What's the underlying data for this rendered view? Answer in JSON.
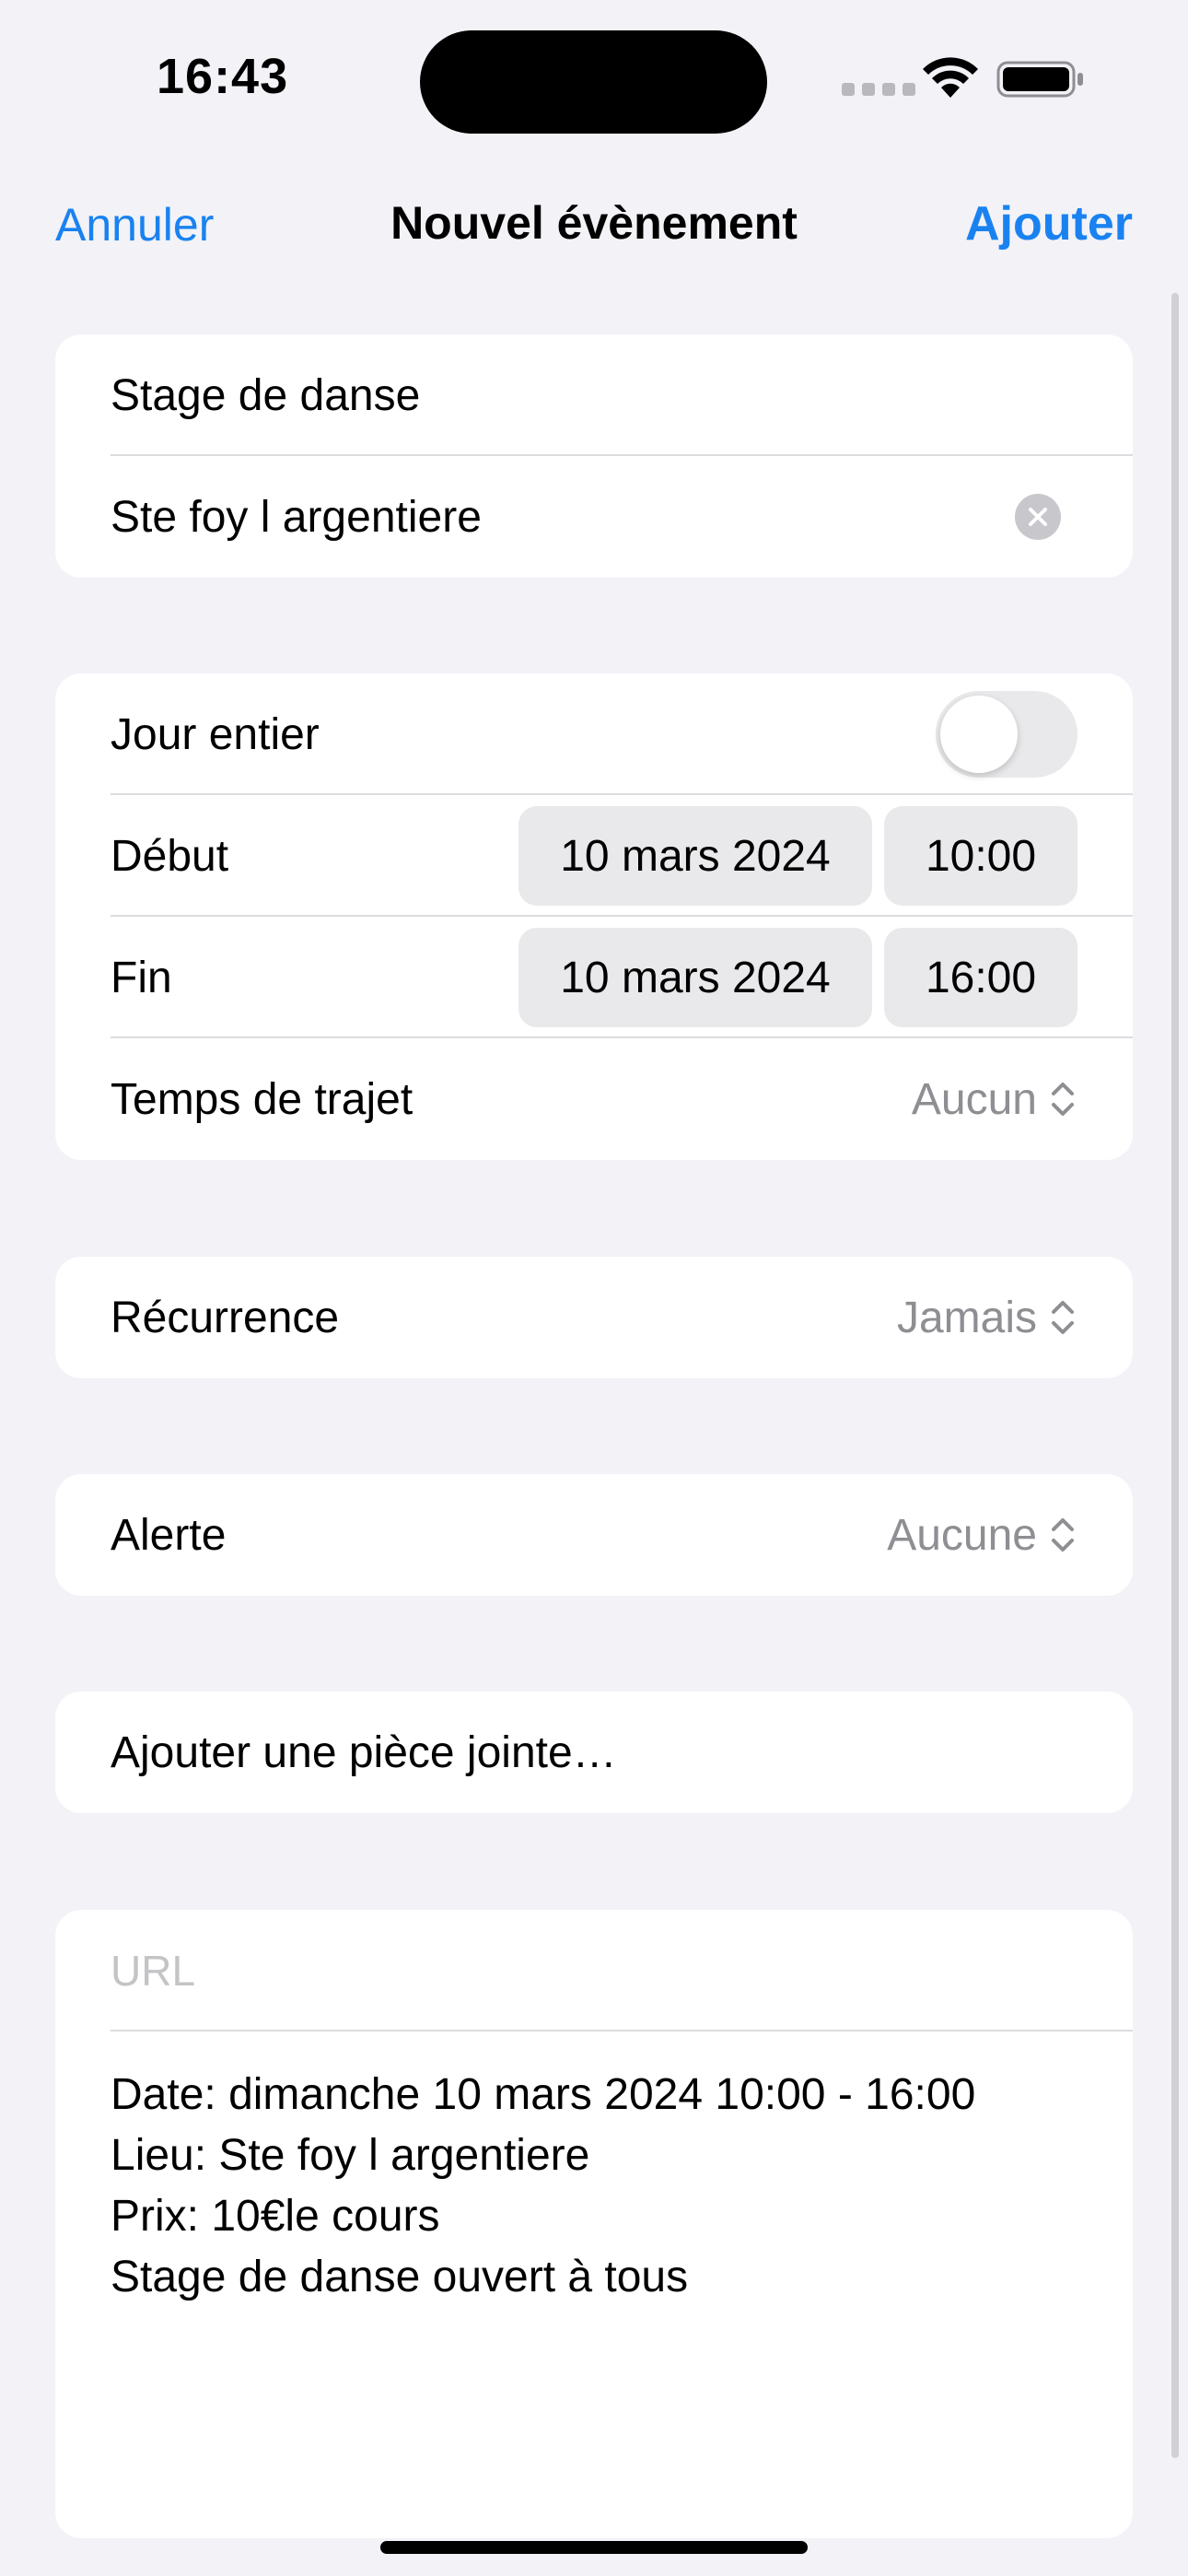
{
  "status_bar": {
    "time": "16:43"
  },
  "nav": {
    "cancel": "Annuler",
    "title": "Nouvel évènement",
    "add": "Ajouter"
  },
  "event": {
    "title": "Stage de danse",
    "location": "Ste foy l argentiere"
  },
  "dates": {
    "all_day_label": "Jour entier",
    "all_day_on": false,
    "start_label": "Début",
    "start_date": "10 mars 2024",
    "start_time": "10:00",
    "end_label": "Fin",
    "end_date": "10 mars 2024",
    "end_time": "16:00",
    "travel_label": "Temps de trajet",
    "travel_value": "Aucun"
  },
  "recurrence": {
    "label": "Récurrence",
    "value": "Jamais"
  },
  "alert": {
    "label": "Alerte",
    "value": "Aucune"
  },
  "attachment": {
    "label": "Ajouter une pièce jointe…"
  },
  "details": {
    "url_placeholder": "URL",
    "notes": [
      "Date: dimanche 10 mars 2024 10:00 - 16:00",
      "Lieu: Ste foy l argentiere",
      "Prix: 10€le cours",
      "Stage de danse ouvert à tous"
    ]
  },
  "colors": {
    "accent": "#1A82F0",
    "background": "#F2F2F7",
    "secondary_text": "#8E8E93"
  },
  "icons": [
    "wifi-icon",
    "battery-icon",
    "signal-icon",
    "clear-icon",
    "chevron-up-down-icon"
  ]
}
